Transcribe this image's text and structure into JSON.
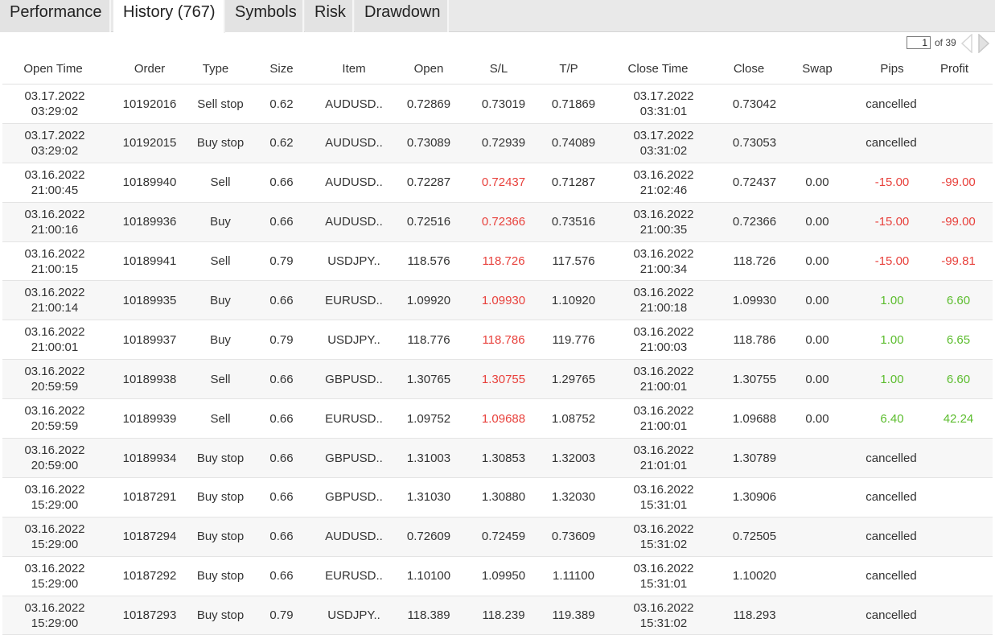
{
  "tabs": [
    {
      "label": "Performance",
      "active": false
    },
    {
      "label": "History (767)",
      "active": true
    },
    {
      "label": "Symbols",
      "active": false
    },
    {
      "label": "Risk",
      "active": false
    },
    {
      "label": "Drawdown",
      "active": false
    }
  ],
  "pager": {
    "page": "1",
    "of_label": "of 39"
  },
  "colors": {
    "negative": "#e8413c",
    "positive": "#5cbd2e"
  },
  "columns": [
    "Open Time",
    "Order",
    "Type",
    "Size",
    "Item",
    "Open",
    "S/L",
    "T/P",
    "Close Time",
    "Close",
    "Swap",
    "Pips",
    "Profit"
  ],
  "rows": [
    {
      "open_date": "03.17.2022",
      "open_time": "03:29:02",
      "order": "10192016",
      "type": "Sell stop",
      "size": "0.62",
      "item": "AUDUSD..",
      "open": "0.72869",
      "sl": "0.73019",
      "tp": "0.71869",
      "close_date": "03.17.2022",
      "close_time": "03:31:01",
      "close": "0.73042",
      "swap": "",
      "pips": "",
      "profit": "",
      "status": "cancelled",
      "sl_color": "",
      "pnl_color": ""
    },
    {
      "open_date": "03.17.2022",
      "open_time": "03:29:02",
      "order": "10192015",
      "type": "Buy stop",
      "size": "0.62",
      "item": "AUDUSD..",
      "open": "0.73089",
      "sl": "0.72939",
      "tp": "0.74089",
      "close_date": "03.17.2022",
      "close_time": "03:31:02",
      "close": "0.73053",
      "swap": "",
      "pips": "",
      "profit": "",
      "status": "cancelled",
      "sl_color": "",
      "pnl_color": ""
    },
    {
      "open_date": "03.16.2022",
      "open_time": "21:00:45",
      "order": "10189940",
      "type": "Sell",
      "size": "0.66",
      "item": "AUDUSD..",
      "open": "0.72287",
      "sl": "0.72437",
      "tp": "0.71287",
      "close_date": "03.16.2022",
      "close_time": "21:02:46",
      "close": "0.72437",
      "swap": "0.00",
      "pips": "-15.00",
      "profit": "-99.00",
      "status": "",
      "sl_color": "red",
      "pnl_color": "red"
    },
    {
      "open_date": "03.16.2022",
      "open_time": "21:00:16",
      "order": "10189936",
      "type": "Buy",
      "size": "0.66",
      "item": "AUDUSD..",
      "open": "0.72516",
      "sl": "0.72366",
      "tp": "0.73516",
      "close_date": "03.16.2022",
      "close_time": "21:00:35",
      "close": "0.72366",
      "swap": "0.00",
      "pips": "-15.00",
      "profit": "-99.00",
      "status": "",
      "sl_color": "red",
      "pnl_color": "red"
    },
    {
      "open_date": "03.16.2022",
      "open_time": "21:00:15",
      "order": "10189941",
      "type": "Sell",
      "size": "0.79",
      "item": "USDJPY..",
      "open": "118.576",
      "sl": "118.726",
      "tp": "117.576",
      "close_date": "03.16.2022",
      "close_time": "21:00:34",
      "close": "118.726",
      "swap": "0.00",
      "pips": "-15.00",
      "profit": "-99.81",
      "status": "",
      "sl_color": "red",
      "pnl_color": "red"
    },
    {
      "open_date": "03.16.2022",
      "open_time": "21:00:14",
      "order": "10189935",
      "type": "Buy",
      "size": "0.66",
      "item": "EURUSD..",
      "open": "1.09920",
      "sl": "1.09930",
      "tp": "1.10920",
      "close_date": "03.16.2022",
      "close_time": "21:00:18",
      "close": "1.09930",
      "swap": "0.00",
      "pips": "1.00",
      "profit": "6.60",
      "status": "",
      "sl_color": "red",
      "pnl_color": "green"
    },
    {
      "open_date": "03.16.2022",
      "open_time": "21:00:01",
      "order": "10189937",
      "type": "Buy",
      "size": "0.79",
      "item": "USDJPY..",
      "open": "118.776",
      "sl": "118.786",
      "tp": "119.776",
      "close_date": "03.16.2022",
      "close_time": "21:00:03",
      "close": "118.786",
      "swap": "0.00",
      "pips": "1.00",
      "profit": "6.65",
      "status": "",
      "sl_color": "red",
      "pnl_color": "green"
    },
    {
      "open_date": "03.16.2022",
      "open_time": "20:59:59",
      "order": "10189938",
      "type": "Sell",
      "size": "0.66",
      "item": "GBPUSD..",
      "open": "1.30765",
      "sl": "1.30755",
      "tp": "1.29765",
      "close_date": "03.16.2022",
      "close_time": "21:00:01",
      "close": "1.30755",
      "swap": "0.00",
      "pips": "1.00",
      "profit": "6.60",
      "status": "",
      "sl_color": "red",
      "pnl_color": "green"
    },
    {
      "open_date": "03.16.2022",
      "open_time": "20:59:59",
      "order": "10189939",
      "type": "Sell",
      "size": "0.66",
      "item": "EURUSD..",
      "open": "1.09752",
      "sl": "1.09688",
      "tp": "1.08752",
      "close_date": "03.16.2022",
      "close_time": "21:00:01",
      "close": "1.09688",
      "swap": "0.00",
      "pips": "6.40",
      "profit": "42.24",
      "status": "",
      "sl_color": "red",
      "pnl_color": "green"
    },
    {
      "open_date": "03.16.2022",
      "open_time": "20:59:00",
      "order": "10189934",
      "type": "Buy stop",
      "size": "0.66",
      "item": "GBPUSD..",
      "open": "1.31003",
      "sl": "1.30853",
      "tp": "1.32003",
      "close_date": "03.16.2022",
      "close_time": "21:01:01",
      "close": "1.30789",
      "swap": "",
      "pips": "",
      "profit": "",
      "status": "cancelled",
      "sl_color": "",
      "pnl_color": ""
    },
    {
      "open_date": "03.16.2022",
      "open_time": "15:29:00",
      "order": "10187291",
      "type": "Buy stop",
      "size": "0.66",
      "item": "GBPUSD..",
      "open": "1.31030",
      "sl": "1.30880",
      "tp": "1.32030",
      "close_date": "03.16.2022",
      "close_time": "15:31:01",
      "close": "1.30906",
      "swap": "",
      "pips": "",
      "profit": "",
      "status": "cancelled",
      "sl_color": "",
      "pnl_color": ""
    },
    {
      "open_date": "03.16.2022",
      "open_time": "15:29:00",
      "order": "10187294",
      "type": "Buy stop",
      "size": "0.66",
      "item": "AUDUSD..",
      "open": "0.72609",
      "sl": "0.72459",
      "tp": "0.73609",
      "close_date": "03.16.2022",
      "close_time": "15:31:02",
      "close": "0.72505",
      "swap": "",
      "pips": "",
      "profit": "",
      "status": "cancelled",
      "sl_color": "",
      "pnl_color": ""
    },
    {
      "open_date": "03.16.2022",
      "open_time": "15:29:00",
      "order": "10187292",
      "type": "Buy stop",
      "size": "0.66",
      "item": "EURUSD..",
      "open": "1.10100",
      "sl": "1.09950",
      "tp": "1.11100",
      "close_date": "03.16.2022",
      "close_time": "15:31:01",
      "close": "1.10020",
      "swap": "",
      "pips": "",
      "profit": "",
      "status": "cancelled",
      "sl_color": "",
      "pnl_color": ""
    },
    {
      "open_date": "03.16.2022",
      "open_time": "15:29:00",
      "order": "10187293",
      "type": "Buy stop",
      "size": "0.79",
      "item": "USDJPY..",
      "open": "118.389",
      "sl": "118.239",
      "tp": "119.389",
      "close_date": "03.16.2022",
      "close_time": "15:31:02",
      "close": "118.293",
      "swap": "",
      "pips": "",
      "profit": "",
      "status": "cancelled",
      "sl_color": "",
      "pnl_color": ""
    }
  ]
}
